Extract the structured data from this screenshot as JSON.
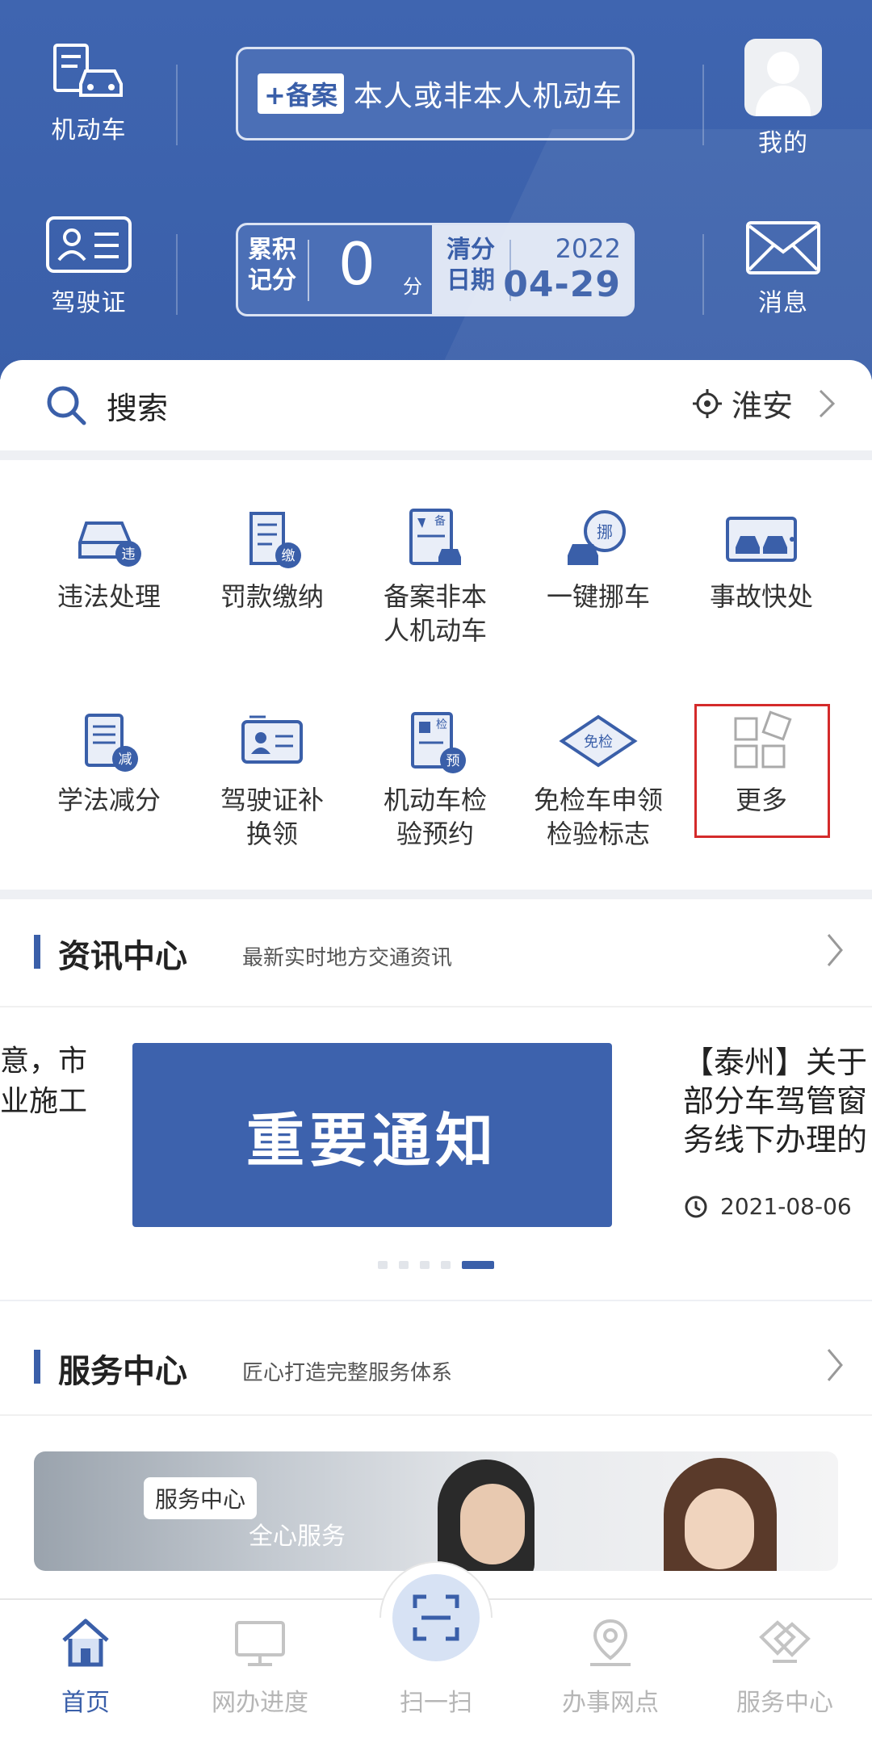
{
  "header": {
    "vehicle_label": "机动车",
    "license_label": "驾驶证",
    "mine_label": "我的",
    "message_label": "消息",
    "beian_tag": "+备案",
    "beian_text": "本人或非本人机动车",
    "score_key": "累积记分",
    "score_value": "0",
    "score_unit": "分",
    "clear_key": "清分日期",
    "clear_year": "2022",
    "clear_date": "04-29"
  },
  "search": {
    "placeholder": "搜索",
    "city": "淮安"
  },
  "services": [
    {
      "label": "违法处理",
      "icon": "violation-car-icon"
    },
    {
      "label": "罚款缴纳",
      "icon": "fine-payment-icon"
    },
    {
      "label": "备案非本\n人机动车",
      "icon": "record-vehicle-icon"
    },
    {
      "label": "一键挪车",
      "icon": "move-car-icon"
    },
    {
      "label": "事故快处",
      "icon": "accident-icon"
    },
    {
      "label": "学法减分",
      "icon": "study-law-icon"
    },
    {
      "label": "驾驶证补\n换领",
      "icon": "license-renew-icon"
    },
    {
      "label": "机动车检\n验预约",
      "icon": "inspection-booking-icon"
    },
    {
      "label": "免检车申领\n检验标志",
      "icon": "exempt-sign-icon"
    },
    {
      "label": "更多",
      "icon": "more-grid-icon"
    }
  ],
  "news": {
    "title": "资讯中心",
    "subtitle": "最新实时地方交通资讯",
    "left_fragment_1": "意，市",
    "left_fragment_2": "业施工",
    "banner_text": "重要通知",
    "right_line_1": "【泰州】关于",
    "right_line_2": "部分车驾管窗",
    "right_line_3": "务线下办理的",
    "right_date": "2021-08-06"
  },
  "service_center": {
    "title": "服务中心",
    "subtitle": "匠心打造完整服务体系",
    "banner_tag": "服务中心",
    "banner_sub": "全心服务"
  },
  "nav": {
    "home": "首页",
    "progress": "网办进度",
    "scan": "扫一扫",
    "outlets": "办事网点",
    "service": "服务中心"
  },
  "colors": {
    "primary": "#3a5fa9",
    "highlight_border": "#d42b2b",
    "inactive": "#b6b6b6"
  }
}
